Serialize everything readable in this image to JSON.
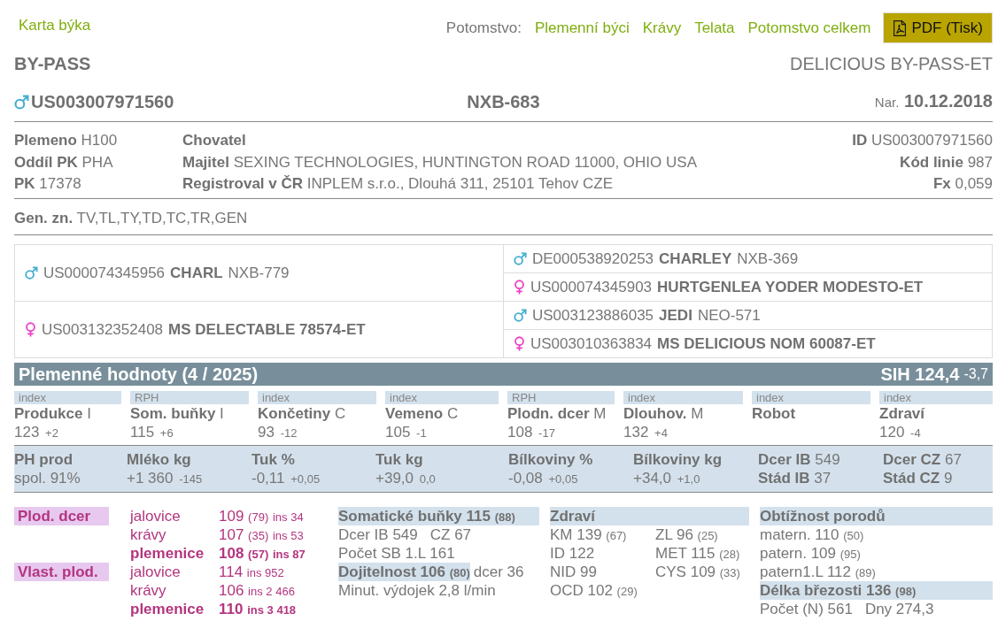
{
  "header": {
    "title": "Karta býka",
    "offspring_label": "Potomstvo:",
    "offspring_links": [
      "Plemenní býci",
      "Krávy",
      "Telata",
      "Potomstvo celkem"
    ],
    "pdf_button": "PDF (Tisk)"
  },
  "animal": {
    "name": "BY-PASS",
    "full_name": "DELICIOUS BY-PASS-ET",
    "kind": "male",
    "id": "US003007971560",
    "code": "NXB-683",
    "birth_label": "Nar.",
    "birth_date": "10.12.2018"
  },
  "details": {
    "columns": [
      [
        {
          "label": "Plemeno",
          "value": "H100"
        },
        {
          "label": "Oddíl PK",
          "value": "PHA"
        },
        {
          "label": "PK",
          "value": "17378"
        }
      ],
      [
        {
          "label": "Chovatel"
        },
        {
          "label": "Majitel",
          "value": "SEXING TECHNOLOGIES, HUNTINGTON ROAD 11000, OHIO USA"
        },
        {
          "label": "Registroval v ČR",
          "value": "INPLEM s.r.o., Dlouhá 311, 25101 Tehov CZE"
        }
      ],
      [
        {
          "label": "ID",
          "value": "US003007971560"
        },
        {
          "label": "Kód linie",
          "value": "987"
        },
        {
          "label": "Fx",
          "value": "0,059"
        }
      ]
    ]
  },
  "genetic_markers": {
    "label": "Gen. zn.",
    "value": "TV,TL,TY,TD,TC,TR,GEN"
  },
  "pedigree": [
    {
      "kind": "male",
      "id": "US000074345956",
      "name": "CHARL",
      "code": "NXB-779",
      "parents": [
        {
          "kind": "male",
          "id": "DE000538920253",
          "name": "CHARLEY",
          "code": "NXB-369"
        },
        {
          "kind": "female",
          "id": "US000074345903",
          "name": "HURTGENLEA YODER MODESTO-ET"
        }
      ]
    },
    {
      "kind": "female",
      "id": "US003132352408",
      "name": "MS DELECTABLE 78574-ET",
      "parents": [
        {
          "kind": "male",
          "id": "US003123886035",
          "name": "JEDI",
          "code": "NEO-571"
        },
        {
          "kind": "female",
          "id": "US003010363834",
          "name": "MS DELICIOUS NOM 60087-ET"
        }
      ]
    }
  ],
  "breeding_values": {
    "title": "Plemenné hodnoty (4 / 2025)",
    "sih": "SIH 124,4",
    "sih_change": "-3,7",
    "indexes": [
      {
        "tag": "index",
        "name": "Produkce",
        "grade": "I",
        "value": "123",
        "change": "+2"
      },
      {
        "tag": "RPH",
        "name": "Som. buňky",
        "grade": "I",
        "value": "115",
        "change": "+6"
      },
      {
        "tag": "index",
        "name": "Končetiny",
        "grade": "C",
        "value": "93",
        "change": "-12"
      },
      {
        "tag": "index",
        "name": "Vemeno",
        "grade": "C",
        "value": "105",
        "change": "-1"
      },
      {
        "tag": "RPH",
        "name": "Plodn. dcer",
        "grade": "M",
        "value": "108",
        "change": "-17"
      },
      {
        "tag": "index",
        "name": "Dlouhov.",
        "grade": "M",
        "value": "132",
        "change": "+4"
      },
      {
        "tag": "index",
        "name": "Robot"
      },
      {
        "tag": "index",
        "name": "Zdraví",
        "value": "120",
        "change": "-4"
      }
    ],
    "production": [
      {
        "kind": "metric",
        "label": "PH prod",
        "value": "spol. 91%"
      },
      {
        "kind": "metric",
        "label": "Mléko kg",
        "value": "+1 360",
        "change": "-145"
      },
      {
        "kind": "metric",
        "label": "Tuk %",
        "value": "-0,11",
        "change": "+0,05"
      },
      {
        "kind": "metric",
        "label": "Tuk kg",
        "value": "+39,0",
        "change": "0,0"
      },
      {
        "kind": "metric",
        "label": "Bílkoviny %",
        "value": "-0,08",
        "change": "+0,05"
      },
      {
        "kind": "metric",
        "label": "Bílkoviny kg",
        "value": "+34,0",
        "change": "+1,0"
      },
      {
        "kind": "counts",
        "lines": [
          {
            "label": "Dcer IB",
            "value": "549"
          },
          {
            "label": "Stád IB",
            "value": "37"
          }
        ]
      },
      {
        "kind": "counts",
        "lines": [
          {
            "label": "Dcer CZ",
            "value": "67"
          },
          {
            "label": "Stád CZ",
            "value": "9"
          }
        ]
      }
    ]
  },
  "fertility": [
    {
      "label": "Plod. dcer",
      "rows": [
        {
          "kind": "part",
          "category": "jalovice",
          "value": "109",
          "reliability": "(79)",
          "inseminations": "ins 34"
        },
        {
          "kind": "part",
          "category": "krávy",
          "value": "107",
          "reliability": "(35)",
          "inseminations": "ins 53"
        },
        {
          "kind": "total",
          "category": "plemenice",
          "value": "108",
          "reliability": "(57)",
          "inseminations": "ins 87"
        }
      ]
    },
    {
      "label": "Vlast. plod.",
      "rows": [
        {
          "kind": "part",
          "category": "jalovice",
          "value": "114",
          "inseminations": "ins 952"
        },
        {
          "kind": "part",
          "category": "krávy",
          "value": "106",
          "inseminations": "ins 2 466"
        },
        {
          "kind": "total",
          "category": "plemenice",
          "value": "110",
          "inseminations": "ins 3 418"
        }
      ]
    }
  ],
  "traits": [
    [
      {
        "kind": "list",
        "title": "Somatické buňky 115",
        "reliability": "(88)",
        "lines": [
          [
            {
              "text": "Dcer IB 549"
            },
            {
              "text": "CZ 67"
            }
          ],
          [
            {
              "text": "Počet SB 1.L 161"
            }
          ]
        ]
      },
      {
        "kind": "list",
        "title": "Dojitelnost 106",
        "reliability": "(80)",
        "note": "dcer 36",
        "lines": [
          [
            {
              "text": "Minut. výdojek 2,8 l/min"
            }
          ]
        ]
      }
    ],
    [
      {
        "kind": "grid",
        "title": "Zdraví",
        "lines": [
          [
            {
              "text": "KM 139",
              "reliability": "(67)"
            },
            {
              "text": "ZL 96",
              "reliability": "(25)"
            }
          ],
          [
            {
              "text": "ID 122"
            },
            {
              "text": "MET 115",
              "reliability": "(28)"
            }
          ],
          [
            {
              "text": "NID 99"
            },
            {
              "text": "CYS 109",
              "reliability": "(33)"
            }
          ],
          [
            {
              "text": "OCD 102",
              "reliability": "(29)"
            }
          ]
        ]
      }
    ],
    [
      {
        "kind": "list",
        "title": "Obtížnost porodů",
        "lines": [
          [
            {
              "text": "matern. 110",
              "reliability": "(50)"
            }
          ],
          [
            {
              "text": "patern. 109",
              "reliability": "(95)"
            }
          ],
          [
            {
              "text": "patern1.L 112",
              "reliability": "(89)"
            }
          ]
        ]
      },
      {
        "kind": "list",
        "title": "Délka březosti 136",
        "reliability": "(98)",
        "lines": [
          [
            {
              "text": "Počet (N) 561"
            },
            {
              "text": "Dny 274,3"
            }
          ]
        ]
      }
    ]
  ]
}
